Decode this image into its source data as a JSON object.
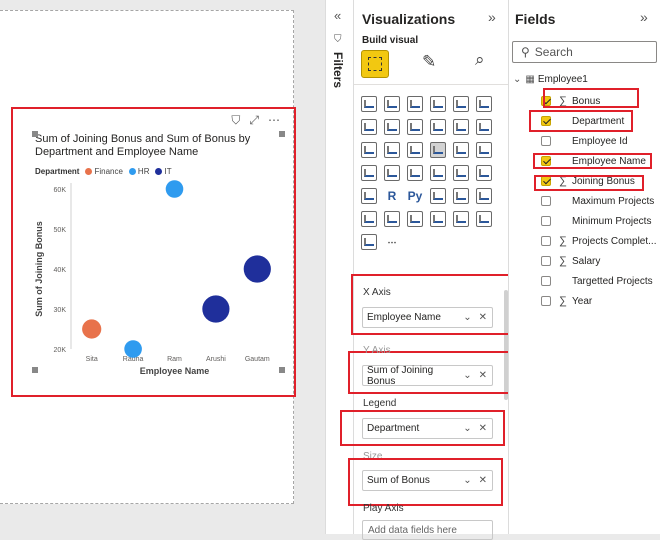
{
  "visual": {
    "title": "Sum of Joining Bonus and Sum of Bonus by Department and Employee Name",
    "legend_title": "Department",
    "legend": [
      {
        "name": "Finance",
        "color": "#e8724b"
      },
      {
        "name": "HR",
        "color": "#2f9bef"
      },
      {
        "name": "IT",
        "color": "#1f2f9b"
      }
    ]
  },
  "chart_data": {
    "type": "scatter",
    "xlabel": "Employee Name",
    "ylabel": "Sum of Joining Bonus",
    "categories": [
      "Sita",
      "Radha",
      "Ram",
      "Arushi",
      "Gautam"
    ],
    "y_ticks": [
      "60K",
      "50K",
      "40K",
      "30K",
      "20K"
    ],
    "ylim": [
      20000,
      60000
    ],
    "points": [
      {
        "x": "Sita",
        "y": 25000,
        "department": "Finance",
        "size": 0.35
      },
      {
        "x": "Radha",
        "y": 20000,
        "department": "HR",
        "size": 0.3
      },
      {
        "x": "Ram",
        "y": 60000,
        "department": "HR",
        "size": 0.3
      },
      {
        "x": "Arushi",
        "y": 30000,
        "department": "IT",
        "size": 0.6
      },
      {
        "x": "Gautam",
        "y": 40000,
        "department": "IT",
        "size": 0.6
      }
    ]
  },
  "filters_label": "Filters",
  "visualizations": {
    "title": "Visualizations",
    "build_visual": "Build visual",
    "glyphs": [
      "R",
      "Py"
    ],
    "wells": [
      {
        "label": "X Axis",
        "value": "Employee Name"
      },
      {
        "label": "Y Axis",
        "value": "Sum of Joining Bonus"
      },
      {
        "label": "Legend",
        "value": "Department"
      },
      {
        "label": "Size",
        "value": "Sum of Bonus"
      }
    ],
    "play_axis": "Play Axis",
    "add_fields": "Add data fields here"
  },
  "fields": {
    "title": "Fields",
    "search_placeholder": "Search",
    "table": "Employee1",
    "items": [
      {
        "label": "Bonus",
        "checked": true,
        "sigma": true
      },
      {
        "label": "Department",
        "checked": true,
        "sigma": false
      },
      {
        "label": "Employee Id",
        "checked": false,
        "sigma": false
      },
      {
        "label": "Employee Name",
        "checked": true,
        "sigma": false
      },
      {
        "label": "Joining Bonus",
        "checked": true,
        "sigma": true
      },
      {
        "label": "Maximum Projects",
        "checked": false,
        "sigma": false
      },
      {
        "label": "Minimum Projects",
        "checked": false,
        "sigma": false
      },
      {
        "label": "Projects Complet...",
        "checked": false,
        "sigma": true
      },
      {
        "label": "Salary",
        "checked": false,
        "sigma": true
      },
      {
        "label": "Targetted Projects",
        "checked": false,
        "sigma": false
      },
      {
        "label": "Year",
        "checked": false,
        "sigma": true
      }
    ]
  }
}
